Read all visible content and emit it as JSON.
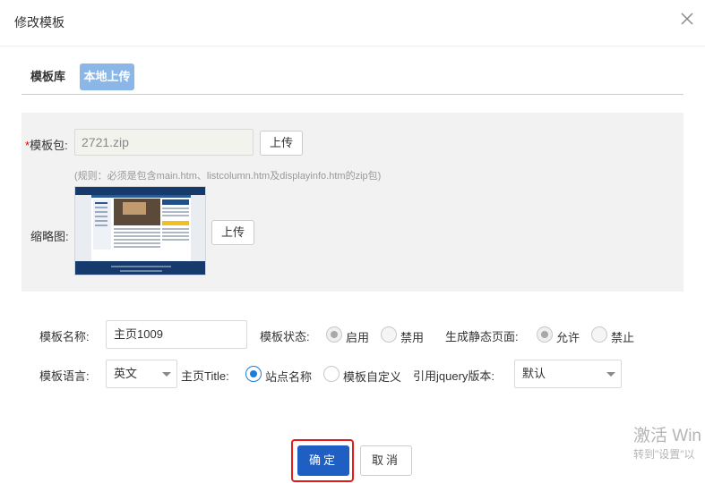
{
  "dialog": {
    "title": "修改模板"
  },
  "tabs": [
    {
      "label": "模板库",
      "active": false
    },
    {
      "label": "本地上传",
      "active": true
    }
  ],
  "upload": {
    "package_label": "模板包:",
    "required_mark": "*",
    "package_value": "2721.zip",
    "upload_button": "上传",
    "rule_text": "(规则：必须是包含main.htm、listcolumn.htm及displayinfo.htm的zip包)",
    "thumbnail_label": "缩略图:",
    "thumbnail_upload_button": "上传"
  },
  "form": {
    "name_label": "模板名称:",
    "name_value": "主页1009",
    "status_label": "模板状态:",
    "status_options": [
      "启用",
      "禁用"
    ],
    "static_label": "生成静态页面:",
    "static_options": [
      "允许",
      "禁止"
    ],
    "language_label": "模板语言:",
    "language_value": "英文",
    "title_label": "主页Title:",
    "title_options": [
      "站点名称",
      "模板自定义"
    ],
    "jquery_label": "引用jquery版本:",
    "jquery_value": "默认"
  },
  "actions": {
    "confirm": "确定",
    "cancel": "取消"
  },
  "watermark": {
    "line1": "激活 Win",
    "line2": "转到\"设置\"以"
  },
  "colors": {
    "primary": "#1f5fc4",
    "tab_active": "#8ab7e8",
    "highlight": "#e81b1b"
  }
}
